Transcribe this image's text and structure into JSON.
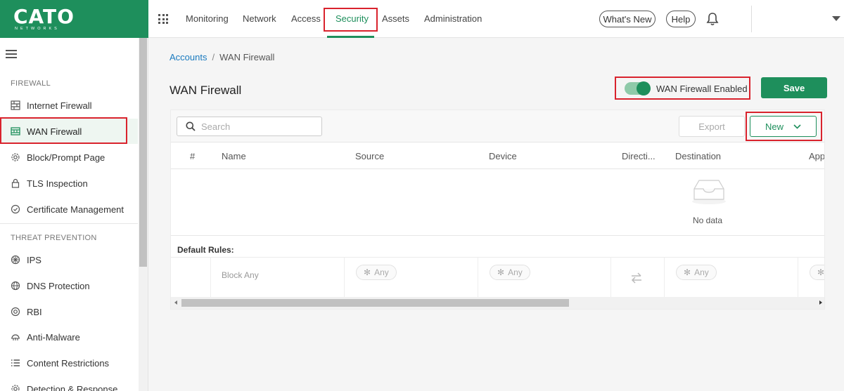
{
  "brand": {
    "name": "CATO",
    "sub": "NETWORKS",
    "color": "#1e8f5c"
  },
  "topnav": {
    "items": [
      {
        "label": "Monitoring"
      },
      {
        "label": "Network"
      },
      {
        "label": "Access"
      },
      {
        "label": "Security",
        "active": true
      },
      {
        "label": "Assets"
      },
      {
        "label": "Administration"
      }
    ],
    "whats_new": "What's New",
    "help": "Help"
  },
  "sidebar": {
    "sections": [
      {
        "title": "FIREWALL",
        "items": [
          {
            "label": "Internet Firewall",
            "icon": "firewall-icon"
          },
          {
            "label": "WAN Firewall",
            "icon": "wan-firewall-icon",
            "active": true
          },
          {
            "label": "Block/Prompt Page",
            "icon": "gear-icon"
          },
          {
            "label": "TLS Inspection",
            "icon": "lock-icon"
          },
          {
            "label": "Certificate Management",
            "icon": "certificate-check-icon"
          }
        ]
      },
      {
        "title": "THREAT PREVENTION",
        "items": [
          {
            "label": "IPS",
            "icon": "shield-spoke-icon"
          },
          {
            "label": "DNS Protection",
            "icon": "globe-icon"
          },
          {
            "label": "RBI",
            "icon": "target-icon"
          },
          {
            "label": "Anti-Malware",
            "icon": "bug-icon"
          },
          {
            "label": "Content Restrictions",
            "icon": "list-icon"
          },
          {
            "label": "Detection & Response",
            "icon": "gear-icon"
          }
        ]
      }
    ]
  },
  "breadcrumb": {
    "link": "Accounts",
    "separator": "/",
    "current": "WAN Firewall"
  },
  "page": {
    "title": "WAN Firewall",
    "toggle_label": "WAN Firewall Enabled",
    "toggle_on": true,
    "save_label": "Save"
  },
  "toolbar": {
    "search_placeholder": "Search",
    "export_label": "Export",
    "new_label": "New"
  },
  "table": {
    "columns": [
      "#",
      "Name",
      "Source",
      "Device",
      "Directi...",
      "Destination",
      "App/"
    ],
    "empty_text": "No data",
    "default_rules_label": "Default Rules:",
    "default_rule": {
      "name": "Block Any",
      "source": "Any",
      "device": "Any",
      "destination": "Any"
    }
  }
}
